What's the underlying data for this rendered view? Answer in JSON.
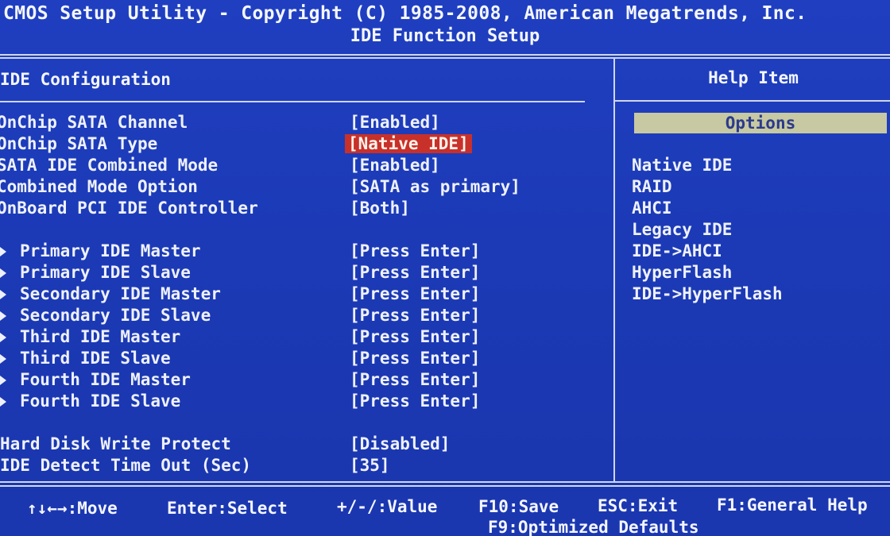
{
  "header": {
    "title": "CMOS Setup Utility - Copyright (C) 1985-2008, American Megatrends, Inc.",
    "subtitle": "IDE Function Setup"
  },
  "left_panel": {
    "section_title": "IDE Configuration",
    "settings": [
      {
        "label": "OnChip SATA Channel",
        "value": "[Enabled]"
      },
      {
        "label": "OnChip SATA Type",
        "value": "[Native IDE]",
        "selected": true
      },
      {
        "label": "SATA IDE Combined Mode",
        "value": "[Enabled]"
      },
      {
        "label": "Combined Mode Option",
        "value": "[SATA as primary]"
      },
      {
        "label": "OnBoard PCI IDE Controller",
        "value": "[Both]"
      }
    ],
    "submenus": [
      {
        "label": "Primary IDE Master",
        "value": "[Press Enter]"
      },
      {
        "label": "Primary IDE Slave",
        "value": "[Press Enter]"
      },
      {
        "label": "Secondary IDE Master",
        "value": "[Press Enter]"
      },
      {
        "label": "Secondary IDE Slave",
        "value": "[Press Enter]"
      },
      {
        "label": "Third IDE Master",
        "value": "[Press Enter]"
      },
      {
        "label": "Third IDE Slave",
        "value": "[Press Enter]"
      },
      {
        "label": "Fourth IDE Master",
        "value": "[Press Enter]"
      },
      {
        "label": "Fourth IDE Slave",
        "value": "[Press Enter]"
      }
    ],
    "bottom_settings": [
      {
        "label": "Hard Disk Write Protect",
        "value": "[Disabled]"
      },
      {
        "label": "IDE Detect Time Out (Sec)",
        "value": "[35]"
      }
    ]
  },
  "right_panel": {
    "help_title": "Help Item",
    "options_header": "Options",
    "options": [
      "Native IDE",
      "RAID",
      "AHCI",
      "Legacy IDE",
      "IDE->AHCI",
      "HyperFlash",
      "IDE->HyperFlash"
    ]
  },
  "footer": {
    "move": "↑↓←→:Move",
    "select": "Enter:Select",
    "value": "+/-/:Value",
    "save": "F10:Save",
    "exit": "ESC:Exit",
    "help": "F1:General Help",
    "defaults": "F9:Optimized Defaults"
  },
  "colors": {
    "background": "#1c3bb8",
    "selected_value": "#c8302a",
    "options_bar": "#c6c9a2",
    "text": "#eef1fb"
  }
}
